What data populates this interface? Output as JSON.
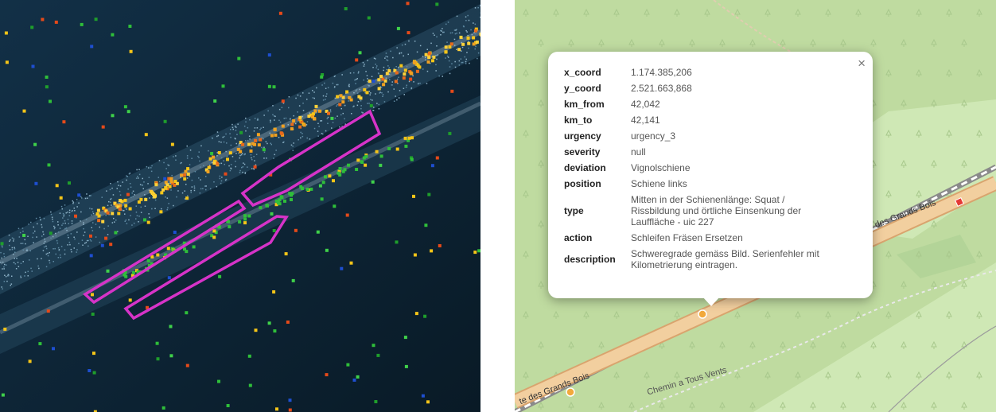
{
  "popup": {
    "close": "×",
    "rows": [
      {
        "key": "x_coord",
        "value": "1.174.385,206"
      },
      {
        "key": "y_coord",
        "value": "2.521.663,868"
      },
      {
        "key": "km_from",
        "value": "42,042"
      },
      {
        "key": "km_to",
        "value": "42,141"
      },
      {
        "key": "urgency",
        "value": "urgency_3"
      },
      {
        "key": "severity",
        "value": "null"
      },
      {
        "key": "deviation",
        "value": "Vignolschiene"
      },
      {
        "key": "position",
        "value": "Schiene links"
      },
      {
        "key": "type",
        "value": "Mitten in der Schienenlänge: Squat / Rissbildung und örtliche Einsenkung der Lauffläche - uic 227"
      },
      {
        "key": "action",
        "value": "Schleifen Fräsen Ersetzen"
      },
      {
        "key": "description",
        "value": "Schweregrade gemäss Bild. Serienfehler mit Kilometrierung eintragen."
      }
    ]
  },
  "map": {
    "road_labels": {
      "upper": "des Grands Bois",
      "lower": "te des Grands Bois",
      "path": "Chemin a Tous Vents"
    }
  },
  "colors": {
    "pointcloud_bg": "#0e2231",
    "highlight": "#d633c8",
    "forest": "#bfdba0",
    "meadow": "#cfe8b5",
    "road": "#f2cf9f"
  }
}
